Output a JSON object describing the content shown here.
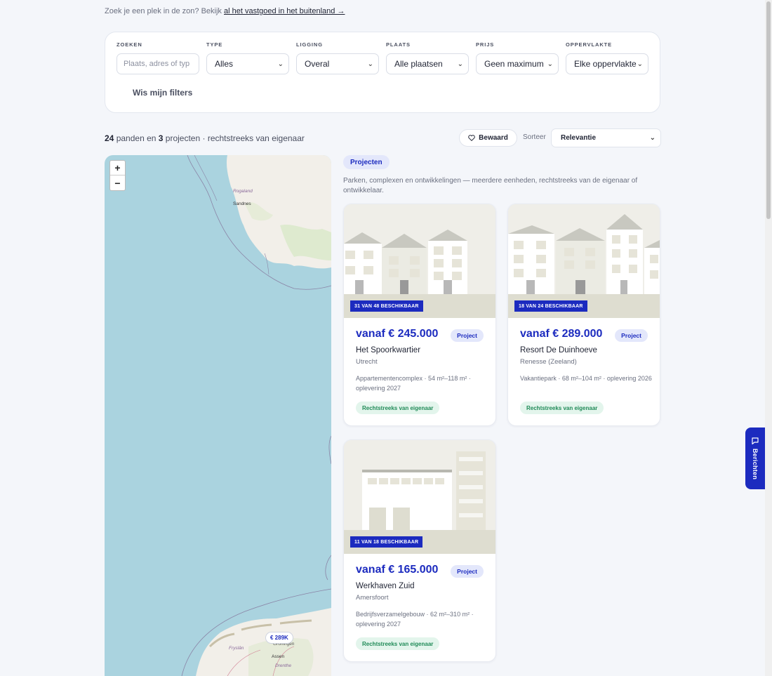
{
  "intro": {
    "text": "Zoek je een plek in de zon? Bekijk ",
    "link": "al het vastgoed in het buitenland →"
  },
  "filters": {
    "search_label": "ZOEKEN",
    "search_placeholder": "Plaats, adres of typ",
    "type_label": "TYPE",
    "type_value": "Alles",
    "location_label": "LIGGING",
    "location_value": "Overal",
    "place_label": "PLAATS",
    "place_value": "Alle plaatsen",
    "price_label": "PRIJS",
    "price_value": "Geen maximum",
    "area_label": "OPPERVLAKTE",
    "area_value": "Elke oppervlakte",
    "clear_label": "Wis mijn filters"
  },
  "results": {
    "properties_count": "24",
    "properties_text": " panden en ",
    "projects_count": "3",
    "projects_text": " projecten · rechtstreeks van eigenaar",
    "saved_label": "Bewaard",
    "sort_label": "Sorteer",
    "sort_value": "Relevantie"
  },
  "map": {
    "zoom_in": "+",
    "zoom_out": "−",
    "labels": {
      "rogaland": "Rogaland",
      "sandnes": "Sandnes",
      "groningen": "Groningen",
      "fryslan": "Fryslân",
      "assen": "Assen",
      "drenthe": "Drenthe"
    },
    "marker_price": "€ 289K"
  },
  "projects": {
    "badge": "Projecten",
    "description": "Parken, complexen en ontwikkelingen — meerdere eenheden, rechtstreeks van de eigenaar of ontwikkelaar.",
    "items": [
      {
        "availability": "31 VAN 48 BESCHIKBAAR",
        "price": "vanaf € 245.000",
        "type": "Project",
        "title": "Het Spoorkwartier",
        "location": "Utrecht",
        "details": "Appartementencomplex · 54 m²–118 m² · oplevering 2027",
        "owner": "Rechtstreeks van eigenaar"
      },
      {
        "availability": "18 VAN 24 BESCHIKBAAR",
        "price": "vanaf € 289.000",
        "type": "Project",
        "title": "Resort De Duinhoeve",
        "location": "Renesse (Zeeland)",
        "details": "Vakantiepark · 68 m²–104 m² · oplevering 2026",
        "owner": "Rechtstreeks van eigenaar"
      },
      {
        "availability": "11 VAN 18 BESCHIKBAAR",
        "price": "vanaf € 165.000",
        "type": "Project",
        "title": "Werkhaven Zuid",
        "location": "Amersfoort",
        "details": "Bedrijfsverzamelgebouw · 62 m²–310 m² · oplevering 2027",
        "owner": "Rechtstreeks van eigenaar"
      }
    ]
  },
  "messages_tab": "Berichten",
  "colors": {
    "accent": "#1c2bbf",
    "owner_badge_bg": "#e3f5ec",
    "owner_badge_text": "#1f8a57",
    "water": "#aad3df",
    "land": "#f2efe9"
  }
}
